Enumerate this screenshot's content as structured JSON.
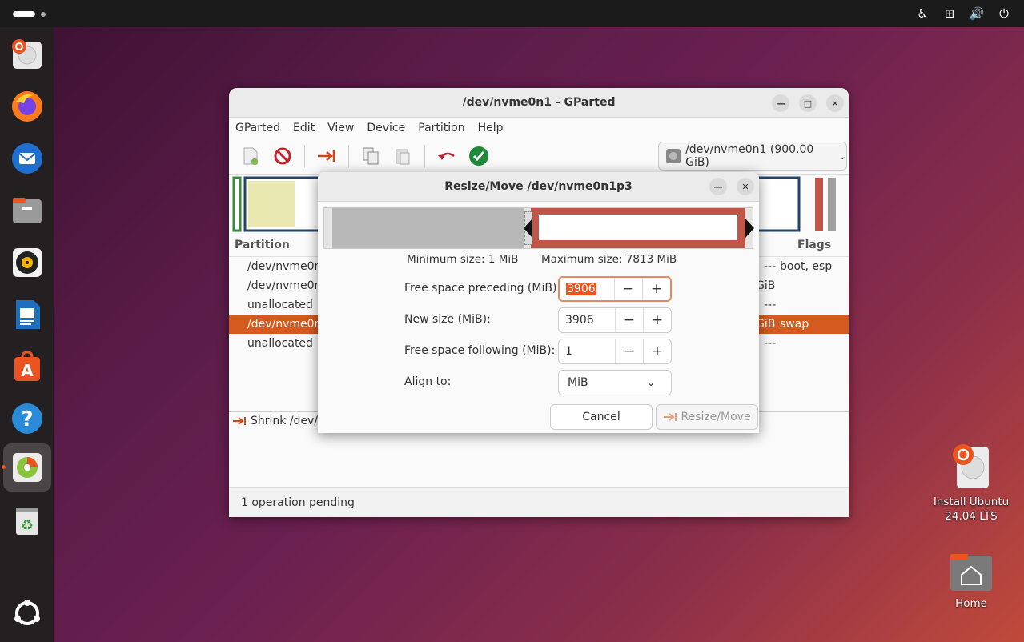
{
  "desktop": {
    "icons": [
      {
        "label": "Install Ubuntu\n24.04 LTS"
      },
      {
        "label": "Home"
      }
    ]
  },
  "gparted": {
    "title": "/dev/nvme0n1 - GParted",
    "menu": [
      "GParted",
      "Edit",
      "View",
      "Device",
      "Partition",
      "Help"
    ],
    "device": "/dev/nvme0n1 (900.00 GiB)",
    "columns": {
      "partition": "Partition",
      "flags": "Flags"
    },
    "rows": [
      {
        "partition": "/dev/nvme0n",
        "size": "---",
        "flags": "boot, esp"
      },
      {
        "partition": "/dev/nvme0n",
        "size": "GiB",
        "flags": ""
      },
      {
        "partition": "unallocated",
        "size": "---",
        "flags": ""
      },
      {
        "partition": "/dev/nvme0n",
        "size": "GiB",
        "flags": "swap"
      },
      {
        "partition": "unallocated",
        "size": "---",
        "flags": ""
      }
    ],
    "pending_operation": "Shrink /dev/n",
    "status": "1 operation pending"
  },
  "dialog": {
    "title": "Resize/Move /dev/nvme0n1p3",
    "min_size": "Minimum size: 1 MiB",
    "max_size": "Maximum size: 7813 MiB",
    "fields": {
      "preceding_label": "Free space preceding (MiB):",
      "preceding_value": "3906",
      "new_size_label": "New size (MiB):",
      "new_size_value": "3906",
      "following_label": "Free space following (MiB):",
      "following_value": "1",
      "align_label": "Align to:",
      "align_value": "MiB"
    },
    "cancel": "Cancel",
    "resize_move": "Resize/Move"
  },
  "colors": {
    "accent": "#e95420",
    "selection": "#d45a1f",
    "partition_border": "#c0564a"
  }
}
